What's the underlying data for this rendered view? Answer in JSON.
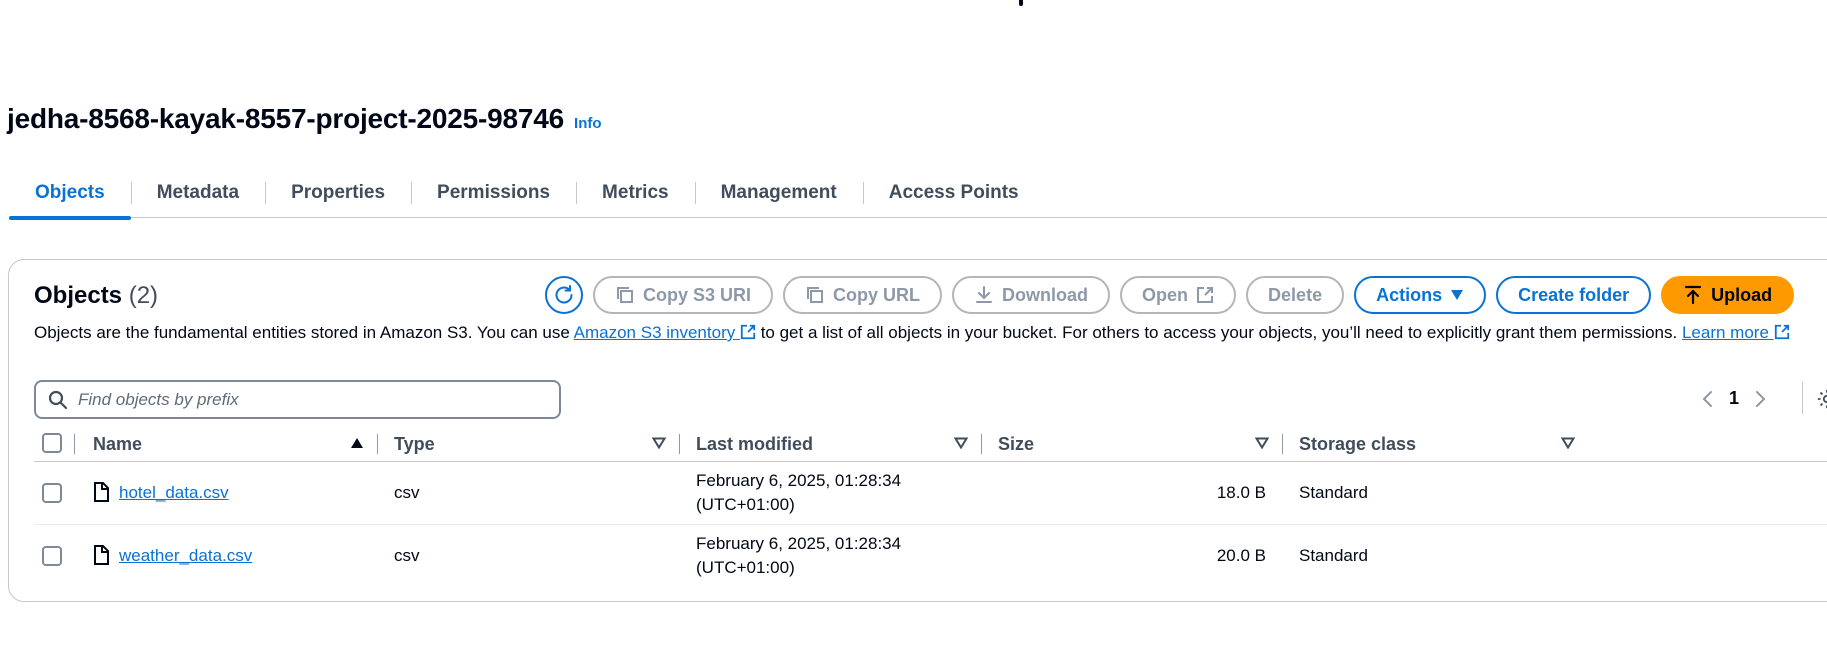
{
  "bucket": {
    "name": "jedha-8568-kayak-8557-project-2025-98746",
    "info_label": "Info"
  },
  "tabs": [
    {
      "label": "Objects",
      "active": true
    },
    {
      "label": "Metadata"
    },
    {
      "label": "Properties"
    },
    {
      "label": "Permissions"
    },
    {
      "label": "Metrics"
    },
    {
      "label": "Management"
    },
    {
      "label": "Access Points"
    }
  ],
  "objects_panel": {
    "title": "Objects",
    "count": "(2)",
    "description_part1": "Objects are the fundamental entities stored in Amazon S3. You can use ",
    "inventory_link": "Amazon S3 inventory",
    "description_part2": " to get a list of all objects in your bucket. For others to access your objects, you’ll need to explicitly grant them permissions. ",
    "learn_more_link": "Learn more"
  },
  "toolbar": {
    "copy_s3_uri": "Copy S3 URI",
    "copy_url": "Copy URL",
    "download": "Download",
    "open": "Open",
    "delete": "Delete",
    "actions": "Actions",
    "create_folder": "Create folder",
    "upload": "Upload"
  },
  "search": {
    "placeholder": "Find objects by prefix"
  },
  "pagination": {
    "current_page": "1"
  },
  "table": {
    "columns": {
      "name": "Name",
      "type": "Type",
      "last_modified": "Last modified",
      "size": "Size",
      "storage_class": "Storage class"
    },
    "rows": [
      {
        "name": "hotel_data.csv",
        "type": "csv",
        "modified_line1": "February 6, 2025, 01:28:34",
        "modified_line2": "(UTC+01:00)",
        "size": "18.0 B",
        "storage_class": "Standard"
      },
      {
        "name": "weather_data.csv",
        "type": "csv",
        "modified_line1": "February 6, 2025, 01:28:34",
        "modified_line2": "(UTC+01:00)",
        "size": "20.0 B",
        "storage_class": "Standard"
      }
    ]
  },
  "colors": {
    "link_blue": "#0972d3",
    "upload_orange": "#ff9900",
    "disabled_gray": "#8d99a8",
    "text_dark": "#000716"
  }
}
